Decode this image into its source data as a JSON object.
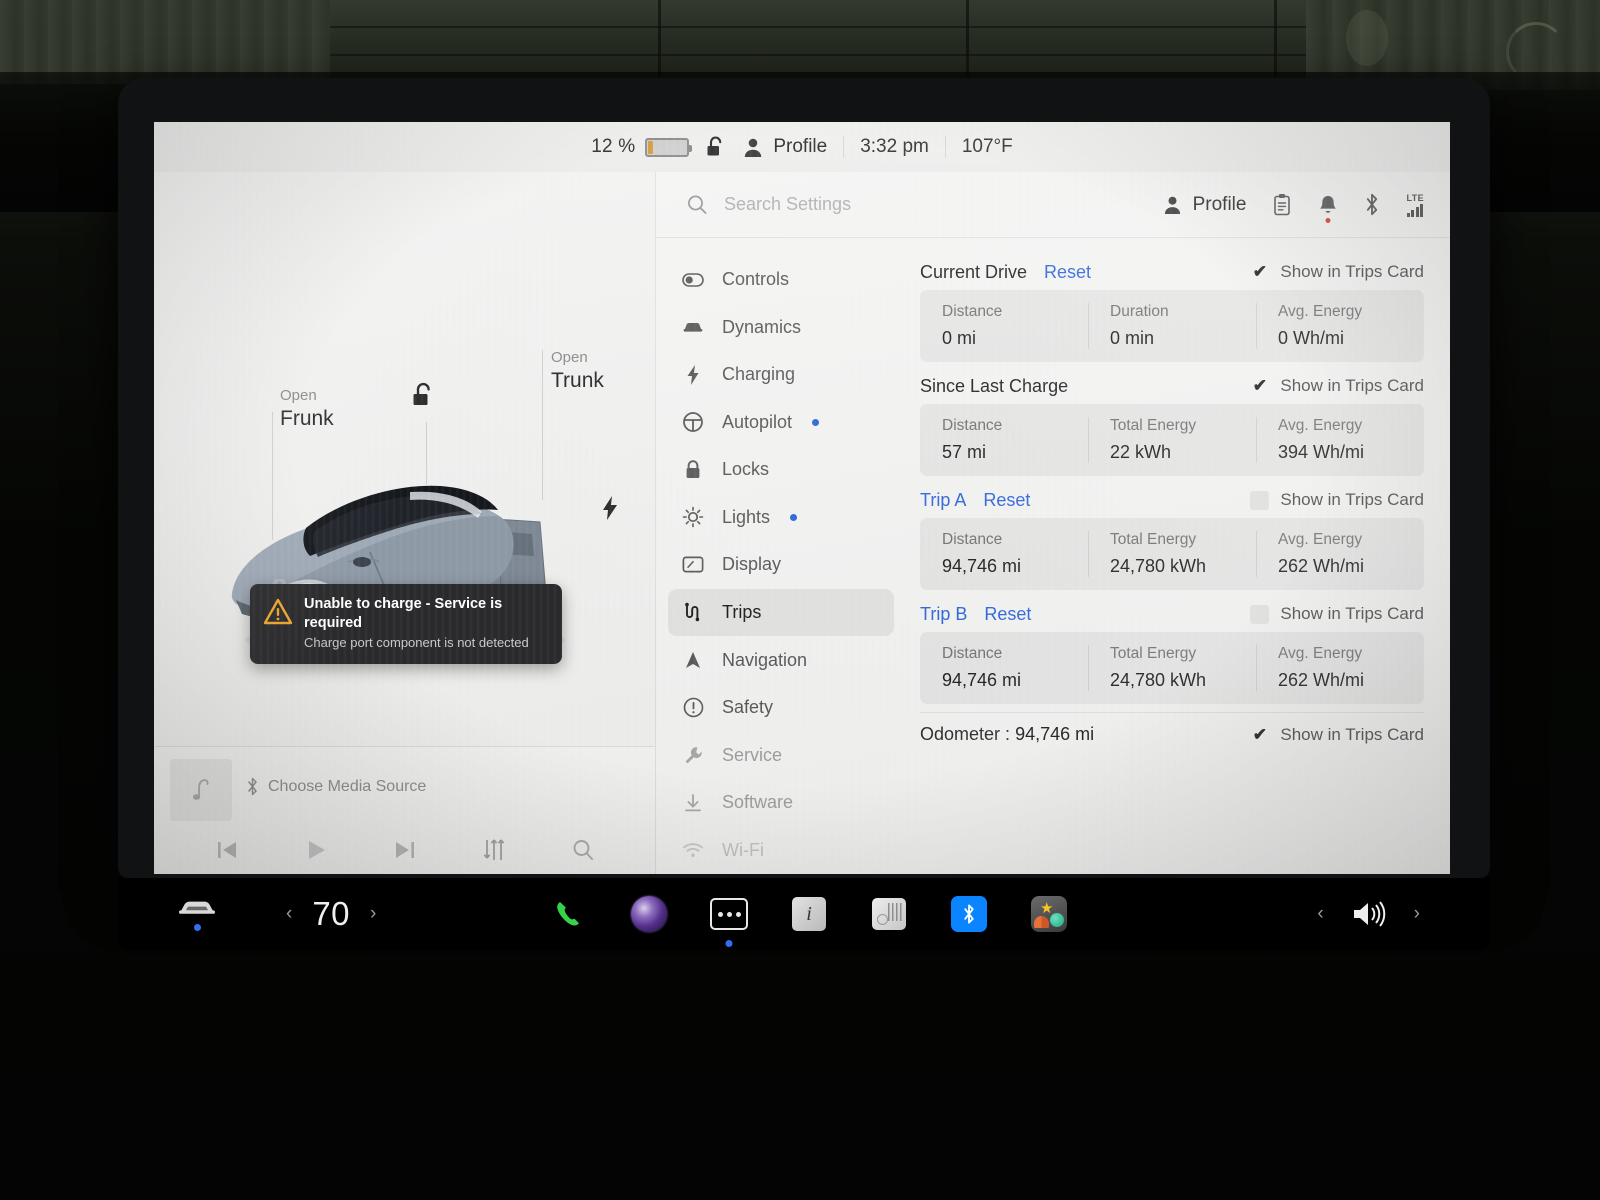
{
  "status_bar": {
    "battery_percent": "12 %",
    "battery_level": 12,
    "lock_icon": "unlock-icon",
    "profile_icon": "person-icon",
    "profile_label": "Profile",
    "time": "3:32 pm",
    "temperature": "107°F"
  },
  "car_pane": {
    "frunk": {
      "action": "Open",
      "target": "Frunk"
    },
    "trunk": {
      "action": "Open",
      "target": "Trunk"
    },
    "lock_icon": "unlock-icon",
    "charge_port_icon": "lightning-bolt-icon",
    "alert": {
      "icon": "warning-triangle-icon",
      "title": "Unable to charge - Service is required",
      "subtitle": "Charge port component is not detected"
    },
    "media": {
      "art_icon": "music-note-icon",
      "source_icon": "bluetooth-icon",
      "source_label": "Choose Media Source",
      "controls": [
        {
          "name": "previous-track-button",
          "icon": "skip-back-icon"
        },
        {
          "name": "play-button",
          "icon": "play-icon"
        },
        {
          "name": "next-track-button",
          "icon": "skip-forward-icon"
        },
        {
          "name": "equalizer-button",
          "icon": "sliders-icon"
        },
        {
          "name": "media-search-button",
          "icon": "search-icon"
        }
      ]
    }
  },
  "settings": {
    "search": {
      "icon": "search-icon",
      "placeholder": "Search Settings",
      "value": ""
    },
    "header_right": {
      "profile_label": "Profile",
      "profile_icon": "person-icon",
      "clipboard_icon": "clipboard-icon",
      "bell_icon": "bell-icon",
      "bell_has_notification": true,
      "bluetooth_icon": "bluetooth-icon",
      "network_label": "LTE",
      "network_icon": "signal-bars-icon"
    },
    "nav_items": [
      {
        "label": "Controls",
        "icon": "toggle-icon",
        "active": false,
        "dot": false,
        "faded": false
      },
      {
        "label": "Dynamics",
        "icon": "car-front-icon",
        "active": false,
        "dot": false,
        "faded": false
      },
      {
        "label": "Charging",
        "icon": "lightning-bolt-icon",
        "active": false,
        "dot": false,
        "faded": false
      },
      {
        "label": "Autopilot",
        "icon": "steering-wheel-icon",
        "active": false,
        "dot": true,
        "faded": false
      },
      {
        "label": "Locks",
        "icon": "lock-icon",
        "active": false,
        "dot": false,
        "faded": false
      },
      {
        "label": "Lights",
        "icon": "sun-lights-icon",
        "active": false,
        "dot": true,
        "faded": false
      },
      {
        "label": "Display",
        "icon": "screen-icon",
        "active": false,
        "dot": false,
        "faded": false
      },
      {
        "label": "Trips",
        "icon": "trips-route-icon",
        "active": true,
        "dot": false,
        "faded": false
      },
      {
        "label": "Navigation",
        "icon": "navigation-arrow-icon",
        "active": false,
        "dot": false,
        "faded": false
      },
      {
        "label": "Safety",
        "icon": "alert-circle-icon",
        "active": false,
        "dot": false,
        "faded": false
      },
      {
        "label": "Service",
        "icon": "wrench-icon",
        "active": false,
        "dot": false,
        "faded": true
      },
      {
        "label": "Software",
        "icon": "download-icon",
        "active": false,
        "dot": false,
        "faded": true
      },
      {
        "label": "Wi-Fi",
        "icon": "wifi-icon",
        "active": false,
        "dot": false,
        "faded": true
      }
    ],
    "show_in_trips_card_label": "Show in Trips Card",
    "reset_label": "Reset",
    "trip_blocks": [
      {
        "title": "Current Drive",
        "title_is_link": false,
        "has_reset": true,
        "checked": true,
        "metrics": [
          {
            "label": "Distance",
            "value": "0 mi"
          },
          {
            "label": "Duration",
            "value": "0 min"
          },
          {
            "label": "Avg. Energy",
            "value": "0 Wh/mi"
          }
        ]
      },
      {
        "title": "Since Last Charge",
        "title_is_link": false,
        "has_reset": false,
        "checked": true,
        "metrics": [
          {
            "label": "Distance",
            "value": "57 mi"
          },
          {
            "label": "Total Energy",
            "value": "22 kWh"
          },
          {
            "label": "Avg. Energy",
            "value": "394 Wh/mi"
          }
        ]
      },
      {
        "title": "Trip A",
        "title_is_link": true,
        "has_reset": true,
        "checked": false,
        "metrics": [
          {
            "label": "Distance",
            "value": "94,746 mi"
          },
          {
            "label": "Total Energy",
            "value": "24,780 kWh"
          },
          {
            "label": "Avg. Energy",
            "value": "262 Wh/mi"
          }
        ]
      },
      {
        "title": "Trip B",
        "title_is_link": true,
        "has_reset": true,
        "checked": false,
        "metrics": [
          {
            "label": "Distance",
            "value": "94,746 mi"
          },
          {
            "label": "Total Energy",
            "value": "24,780 kWh"
          },
          {
            "label": "Avg. Energy",
            "value": "262 Wh/mi"
          }
        ]
      }
    ],
    "odometer": {
      "label": "Odometer :",
      "value": "94,746 mi",
      "checked": true
    }
  },
  "dock": {
    "car_icon": "car-icon",
    "temp_prev_icon": "chevron-left-icon",
    "temp_value": "70",
    "temp_next_icon": "chevron-right-icon",
    "apps": [
      {
        "name": "phone-app",
        "icon": "phone-icon"
      },
      {
        "name": "voice-app",
        "icon": "orb-icon"
      },
      {
        "name": "more-apps",
        "icon": "ellipsis-icon",
        "has_dot": true
      },
      {
        "name": "info-app",
        "icon": "info-icon"
      },
      {
        "name": "tuner-app",
        "icon": "radio-tuner-icon"
      },
      {
        "name": "bluetooth-app",
        "icon": "bluetooth-icon"
      },
      {
        "name": "toybox-app",
        "icon": "toybox-icon"
      }
    ],
    "volume_prev_icon": "chevron-left-icon",
    "volume_icon": "speaker-icon",
    "volume_next_icon": "chevron-right-icon"
  },
  "colors": {
    "accent_blue": "#2a62d8",
    "alert_orange": "#f0a62c",
    "dock_blue_dot": "#2f6ff0",
    "notification_red": "#e03b2f",
    "phone_green": "#35d24a",
    "bluetooth_blue": "#0a84ff"
  }
}
